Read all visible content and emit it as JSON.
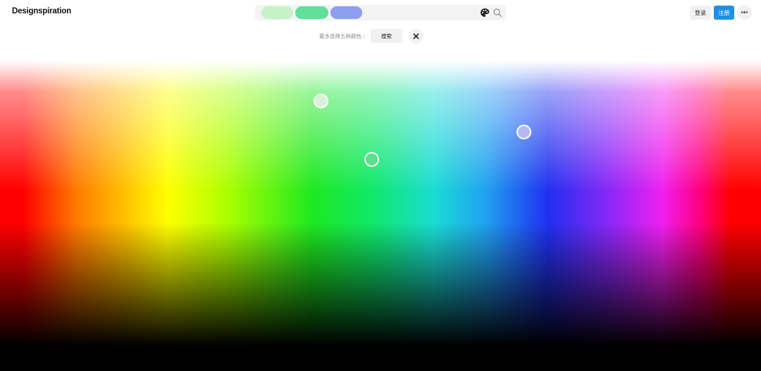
{
  "header": {
    "logo": "Designspiration",
    "login_label": "登录",
    "signup_label": "注册"
  },
  "search": {
    "swatches": [
      {
        "color": "#c6f2c8"
      },
      {
        "color": "#61df9b"
      },
      {
        "color": "#8d9ef1"
      }
    ]
  },
  "toolbar": {
    "hint": "最多选择五种颜色 :",
    "search_label": "搜索"
  },
  "picker": {
    "handles": [
      {
        "color": "#d7f2d5"
      },
      {
        "color": "#b6b8f2"
      },
      {
        "color": "#5de08c"
      }
    ]
  },
  "colors": {
    "accent": "#1d91e8"
  }
}
